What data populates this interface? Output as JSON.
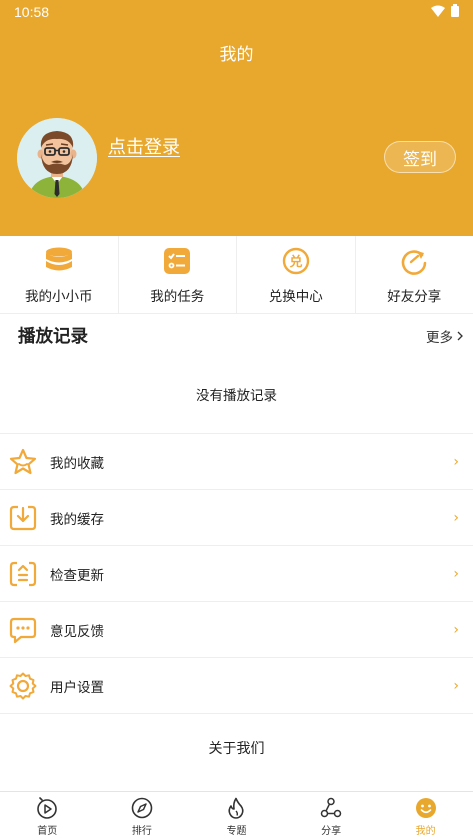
{
  "status_bar": {
    "time": "10:58"
  },
  "header": {
    "title": "我的",
    "login_text": "点击登录",
    "checkin_label": "签到"
  },
  "quick_actions": [
    {
      "label": "我的小小币",
      "icon": "coins-stack-icon"
    },
    {
      "label": "我的任务",
      "icon": "task-list-icon"
    },
    {
      "label": "兑换中心",
      "icon": "exchange-icon"
    },
    {
      "label": "好友分享",
      "icon": "share-arrow-icon"
    }
  ],
  "history": {
    "title": "播放记录",
    "more_label": "更多",
    "empty_text": "没有播放记录"
  },
  "menu": [
    {
      "label": "我的收藏",
      "icon": "star-icon"
    },
    {
      "label": "我的缓存",
      "icon": "download-icon"
    },
    {
      "label": "检查更新",
      "icon": "update-icon"
    },
    {
      "label": "意见反馈",
      "icon": "feedback-icon"
    },
    {
      "label": "用户设置",
      "icon": "settings-gear-icon"
    }
  ],
  "about_label": "关于我们",
  "bottom_nav": [
    {
      "label": "首页",
      "icon": "home-play-icon"
    },
    {
      "label": "排行",
      "icon": "compass-icon"
    },
    {
      "label": "专题",
      "icon": "flame-icon"
    },
    {
      "label": "分享",
      "icon": "share-nodes-icon"
    },
    {
      "label": "我的",
      "icon": "smile-icon",
      "active": true
    }
  ],
  "colors": {
    "accent": "#E8A82E",
    "text": "#222222",
    "divider": "#eeeeee"
  }
}
